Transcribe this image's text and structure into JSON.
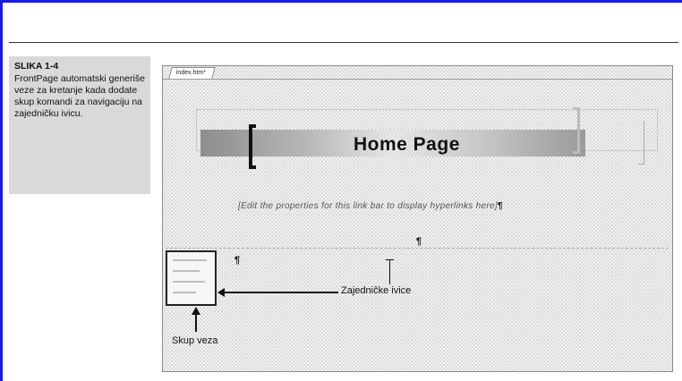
{
  "caption": {
    "label": "SLIKA 1-4",
    "text": "FrontPage automatski generiše veze za kretanje kada dodate skup komandi za navigaciju na zajedničku ivicu."
  },
  "screenshot": {
    "tab_label": "index.htm*",
    "page_title": "Home Page",
    "hint_text": "[Edit the properties for this link bar to display hyperlinks here]",
    "pilcrow": "¶",
    "center_mark": "¶",
    "small_mark": "¶",
    "callout_shared_borders": "Zajedničke ivice",
    "callout_link_set": "Skup veza"
  }
}
